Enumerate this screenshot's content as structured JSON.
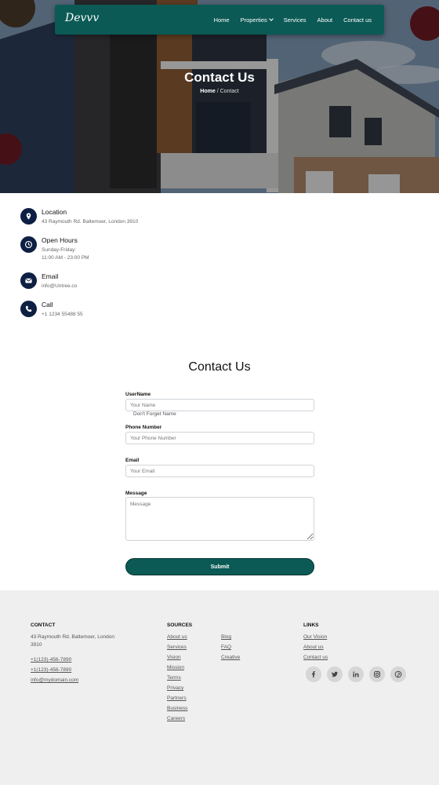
{
  "nav": {
    "brand": "Devvv",
    "items": [
      "Home",
      "Properties",
      "Services",
      "About",
      "Contact us"
    ]
  },
  "hero": {
    "title": "Contact Us",
    "breadcrumb_home": "Home",
    "breadcrumb_sep": "/",
    "breadcrumb_current": "Contact"
  },
  "info": [
    {
      "title": "Location",
      "lines": [
        "43 Raymouth Rd. Baltemoer, London 3910"
      ],
      "icon": "location-pin-icon"
    },
    {
      "title": "Open Hours",
      "lines": [
        "Sunday-Friday:",
        "11:00 AM - 23:00 PM"
      ],
      "icon": "clock-icon"
    },
    {
      "title": "Email",
      "lines": [
        "info@Untree.co"
      ],
      "icon": "envelope-icon"
    },
    {
      "title": "Call",
      "lines": [
        "+1 1234 55488 55"
      ],
      "icon": "phone-icon"
    }
  ],
  "form": {
    "heading": "Contact Us",
    "username_label": "UserName",
    "username_placeholder": "Your Name",
    "username_hint": "Don't Forget Name",
    "phone_label": "Phone Number",
    "phone_placeholder": "Your Phone Number",
    "email_label": "Email",
    "email_placeholder": "Your Email",
    "message_label": "Message",
    "message_placeholder": "Message",
    "submit_label": "Submit"
  },
  "footer": {
    "contact_heading": "CONTACT",
    "address_line1": "43 Raymouth Rd. Baltemoer, London",
    "address_line2": "3910",
    "phones": [
      "+1(123)-456-7890",
      "+1(123)-456-7890"
    ],
    "email": "info@mydomain.com",
    "sources_heading": "SOURCES",
    "sources_col1": [
      "About us",
      "Services",
      "Vision",
      "Mission",
      "Terms",
      "Privacy",
      "Partners",
      "Business",
      "Careers"
    ],
    "sources_col2": [
      "Blog",
      "FAQ",
      "Creative"
    ],
    "links_heading": "LINKS",
    "links": [
      "Our Vision",
      "About us",
      "Contact us"
    ],
    "social": [
      "facebook-icon",
      "twitter-icon",
      "linkedin-icon",
      "instagram-icon",
      "pinterest-icon"
    ]
  },
  "colors": {
    "primary": "#0b5a55",
    "icon_bg": "#0d1f42",
    "footer_bg": "#efefef"
  }
}
